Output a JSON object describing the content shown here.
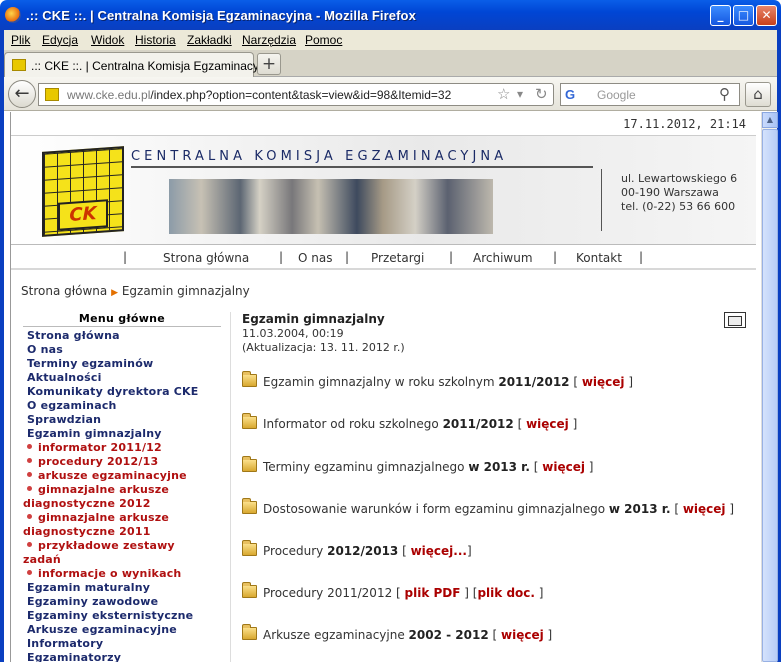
{
  "window": {
    "title": ".:: CKE ::. | Centralna Komisja Egzaminacyjna - Mozilla Firefox",
    "min": "_",
    "max": "□",
    "close": "✕"
  },
  "menu": [
    "Plik",
    "Edycja",
    "Widok",
    "Historia",
    "Zakładki",
    "Narzędzia",
    "Pomoc"
  ],
  "tab": {
    "label": ".:: CKE ::. | Centralna Komisja Egzaminacyjna",
    "new": "+"
  },
  "nav": {
    "url_host": "www.cke.edu.pl",
    "url_rest": "/index.php?option=content&task=view&id=98&Itemid=32",
    "search_placeholder": "Google",
    "back": "←",
    "home": "⌂",
    "star": "☆",
    "down": "▾",
    "reload": "↻",
    "g": "G",
    "mag": "⚲"
  },
  "page": {
    "date": "17.11.2012, 21:14",
    "org_name": "CENTRALNA KOMISJA EGZAMINACYJNA",
    "logo_text": "CK",
    "address": [
      "ul. Lewartowskiego 6",
      "00-190 Warszawa",
      "tel. (0-22) 53 66 600"
    ],
    "topnav": [
      "Strona główna",
      "O nas",
      "Przetargi",
      "Archiwum",
      "Kontakt"
    ],
    "breadcrumb": {
      "home": "Strona główna",
      "current": "Egzamin gimnazjalny",
      "arrow": "▶"
    },
    "sidebar": {
      "title": "Menu główne",
      "items": [
        {
          "t": "Strona główna",
          "k": "item"
        },
        {
          "t": "O nas",
          "k": "item"
        },
        {
          "t": "Terminy egzaminów",
          "k": "item"
        },
        {
          "t": "Aktualności",
          "k": "item"
        },
        {
          "t": "Komunikaty dyrektora CKE",
          "k": "item"
        },
        {
          "t": "O egzaminach",
          "k": "item"
        },
        {
          "t": "Sprawdzian",
          "k": "item"
        },
        {
          "t": "Egzamin gimnazjalny",
          "k": "item"
        },
        {
          "t": "informator 2011/12",
          "k": "sub"
        },
        {
          "t": "procedury 2012/13",
          "k": "sub"
        },
        {
          "t": "arkusze egzaminacyjne",
          "k": "sub"
        },
        {
          "t": "gimnazjalne arkusze",
          "k": "sub"
        },
        {
          "t": "diagnostyczne 2012",
          "k": "cont"
        },
        {
          "t": "gimnazjalne arkusze",
          "k": "sub"
        },
        {
          "t": "diagnostyczne 2011",
          "k": "cont"
        },
        {
          "t": "przykładowe zestawy",
          "k": "sub"
        },
        {
          "t": "zadań",
          "k": "cont"
        },
        {
          "t": "informacje o wynikach",
          "k": "sub"
        },
        {
          "t": "Egzamin maturalny",
          "k": "item"
        },
        {
          "t": "Egzaminy zawodowe",
          "k": "item"
        },
        {
          "t": "Egzaminy eksternistyczne",
          "k": "item"
        },
        {
          "t": "Arkusze egzaminacyjne",
          "k": "item"
        },
        {
          "t": "Informatory",
          "k": "item"
        },
        {
          "t": "Egzaminatorzy",
          "k": "item"
        }
      ]
    },
    "content": {
      "title": "Egzamin gimnazjalny",
      "date": "11.03.2004, 00:19",
      "updated": "(Aktualizacja: 13. 11. 2012 r.)",
      "rows": [
        {
          "pre": "Egzamin gimnazjalny w roku szkolnym ",
          "bold": "2011/2012",
          "mid": " [ ",
          "link": "więcej",
          "post": " ]"
        },
        {
          "pre": "Informator od roku szkolnego ",
          "bold": "2011/2012",
          "mid": " [ ",
          "link": "więcej",
          "post": " ]"
        },
        {
          "pre": "Terminy egzaminu gimnazjalnego ",
          "bold": "w 2013 r.",
          "mid": " [ ",
          "link": "więcej",
          "post": " ]"
        },
        {
          "pre": "Dostosowanie warunków i form egzaminu gimnazjalnego ",
          "bold": "w 2013 r.",
          "mid": " [ ",
          "link": "więcej",
          "post": " ]"
        },
        {
          "pre": "Procedury ",
          "bold": "2012/2013",
          "mid": "  [ ",
          "link": "więcej...",
          "post": "]"
        },
        {
          "pre": "Procedury 2011/2012 [ ",
          "bold": "",
          "mid": "",
          "link": "plik PDF",
          "post": " ]  [plik doc. ]",
          "link2": "plik doc."
        },
        {
          "pre": "Arkusze egzaminacyjne  ",
          "bold": "2002 - 2012",
          "mid": " [ ",
          "link": "więcej",
          "post": " ]"
        }
      ]
    }
  }
}
